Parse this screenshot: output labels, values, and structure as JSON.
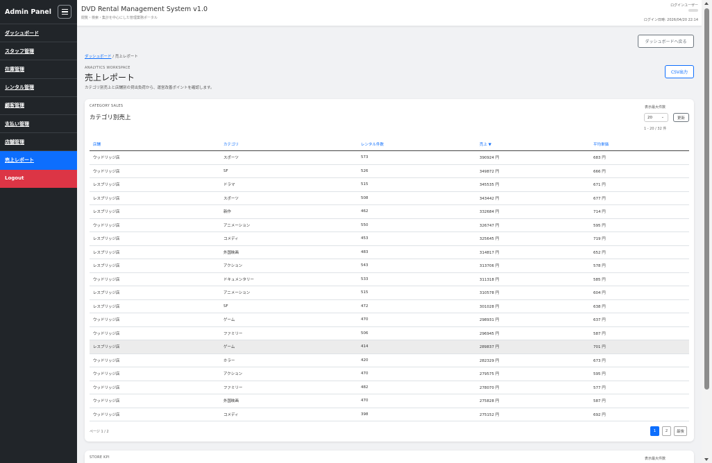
{
  "sidebar": {
    "title": "Admin Panel",
    "items": [
      {
        "label": "ダッシュボード"
      },
      {
        "label": "スタッフ管理"
      },
      {
        "label": "在庫管理"
      },
      {
        "label": "レンタル管理"
      },
      {
        "label": "顧客管理"
      },
      {
        "label": "支払い管理"
      },
      {
        "label": "店舗管理"
      },
      {
        "label": "売上レポート"
      },
      {
        "label": "Logout"
      }
    ],
    "active_color": "#0d6efd",
    "logout_color": "#dc3545"
  },
  "header": {
    "title": "DVD Rental Management System v1.0",
    "subtitle": "閲覧・検索・集計を中心にした管理業務ポータル",
    "user_label": "ログインユーザー",
    "login_time": "ログイン日時: 2026/04/20 22:14"
  },
  "main": {
    "back_button": "ダッシュボードへ戻る",
    "breadcrumb_home": "ダッシュボード",
    "breadcrumb_sep": "/",
    "breadcrumb_current": "売上レポート",
    "workspace_label": "ANALYTICS WORKSPACE",
    "title": "売上レポート",
    "description": "カテゴリ別売上と店舗別の貸出負荷から、運営改善ポイントを確認します。",
    "csv_button": "CSV出力"
  },
  "card": {
    "label": "CATEGORY SALES",
    "title": "カテゴリ別売上",
    "page_size_label": "表示最大件数",
    "page_size_value": "20",
    "refresh_button": "更新",
    "count_text": "1 - 20 / 32 件",
    "columns": [
      "店舗",
      "カテゴリ",
      "レンタル件数",
      "売上 ▼",
      "平均単価"
    ],
    "rows": [
      [
        "ウッドリッジ店",
        "スポーツ",
        "573",
        "390924 円",
        "683 円"
      ],
      [
        "ウッドリッジ店",
        "SF",
        "526",
        "349872 円",
        "666 円"
      ],
      [
        "レスブリッジ店",
        "ドラマ",
        "515",
        "345535 円",
        "671 円"
      ],
      [
        "レスブリッジ店",
        "スポーツ",
        "508",
        "343442 円",
        "677 円"
      ],
      [
        "レスブリッジ店",
        "新作",
        "462",
        "332684 円",
        "714 円"
      ],
      [
        "ウッドリッジ店",
        "アニメーション",
        "550",
        "326747 円",
        "595 円"
      ],
      [
        "レスブリッジ店",
        "コメディ",
        "453",
        "325645 円",
        "719 円"
      ],
      [
        "レスブリッジ店",
        "外国映画",
        "483",
        "314817 円",
        "652 円"
      ],
      [
        "レスブリッジ店",
        "アクション",
        "543",
        "313706 円",
        "578 円"
      ],
      [
        "ウッドリッジ店",
        "ドキュメンタリー",
        "533",
        "311318 円",
        "585 円"
      ],
      [
        "レスブリッジ店",
        "アニメーション",
        "515",
        "310578 円",
        "604 円"
      ],
      [
        "レスブリッジ店",
        "SF",
        "472",
        "301028 円",
        "638 円"
      ],
      [
        "ウッドリッジ店",
        "ゲーム",
        "470",
        "298931 円",
        "637 円"
      ],
      [
        "ウッドリッジ店",
        "ファミリー",
        "506",
        "296945 円",
        "587 円"
      ],
      [
        "レスブリッジ店",
        "ゲーム",
        "414",
        "289837 円",
        "701 円"
      ],
      [
        "ウッドリッジ店",
        "ホラー",
        "420",
        "282329 円",
        "673 円"
      ],
      [
        "ウッドリッジ店",
        "アクション",
        "470",
        "279575 円",
        "595 円"
      ],
      [
        "ウッドリッジ店",
        "ファミリー",
        "482",
        "278070 円",
        "577 円"
      ],
      [
        "ウッドリッジ店",
        "外国映画",
        "470",
        "275828 円",
        "587 円"
      ],
      [
        "ウッドリッジ店",
        "コメディ",
        "398",
        "275152 円",
        "692 円"
      ]
    ],
    "page_info": "ページ 1 / 2",
    "pager": [
      "1",
      "2",
      "最後"
    ]
  },
  "card2": {
    "label": "STORE KPI",
    "page_size_label": "表示最大件数"
  }
}
